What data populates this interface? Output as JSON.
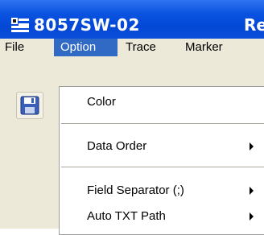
{
  "window": {
    "title": "8057SW-02",
    "title_clipped": "Re"
  },
  "menubar": {
    "items": [
      {
        "label": "File"
      },
      {
        "label": "Option",
        "active": true
      },
      {
        "label": "Trace"
      },
      {
        "label": "Marker"
      }
    ]
  },
  "option_menu": {
    "items": [
      {
        "label": "Color",
        "submenu": false
      },
      {
        "label": "Data Order",
        "submenu": true
      },
      {
        "label": "Field Separator (;)",
        "submenu": true
      },
      {
        "label": "Auto TXT Path",
        "submenu": true
      }
    ]
  },
  "toolbar": {
    "buttons": [
      {
        "icon": "floppy-disk-icon"
      }
    ]
  },
  "colors": {
    "titlebar": "#0347d6",
    "menu_highlight": "#316ac5",
    "menubar_bg": "#ece9d8"
  }
}
